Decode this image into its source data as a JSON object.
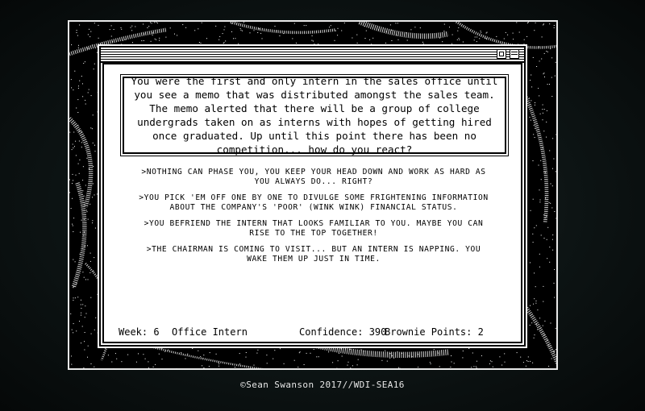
{
  "scene": {
    "story": "You were the first and only intern in the sales office until you see a memo that was distributed amongst the sales team. The memo alerted that there will be a group of college undergrads taken on as interns with hopes of getting hired once graduated. Up until this point there has been no competition... how do you react?",
    "choices": [
      ">NOTHING CAN PHASE YOU, YOU KEEP YOUR HEAD DOWN AND WORK AS HARD AS YOU ALWAYS DO... RIGHT?",
      ">YOU PICK 'EM OFF ONE BY ONE TO DIVULGE SOME FRIGHTENING INFORMATION ABOUT THE COMPANY'S 'POOR' (WINK WINK) FINANCIAL STATUS.",
      ">YOU BEFRIEND THE INTERN THAT LOOKS FAMILIAR TO YOU. MAYBE YOU CAN RISE TO THE TOP TOGETHER!",
      ">THE CHAIRMAN IS COMING TO VISIT... BUT AN INTERN IS NAPPING. YOU WAKE THEM UP JUST IN TIME."
    ]
  },
  "status": {
    "week": "Week: 6",
    "title": "Office Intern",
    "confidence": "Confidence: 390",
    "brownie": "Brownie Points: 2"
  },
  "footer": "©Sean Swanson 2017//WDI-SEA16",
  "colors": {
    "background": "#0d1414",
    "paper": "#ffffff",
    "ink": "#000000"
  }
}
